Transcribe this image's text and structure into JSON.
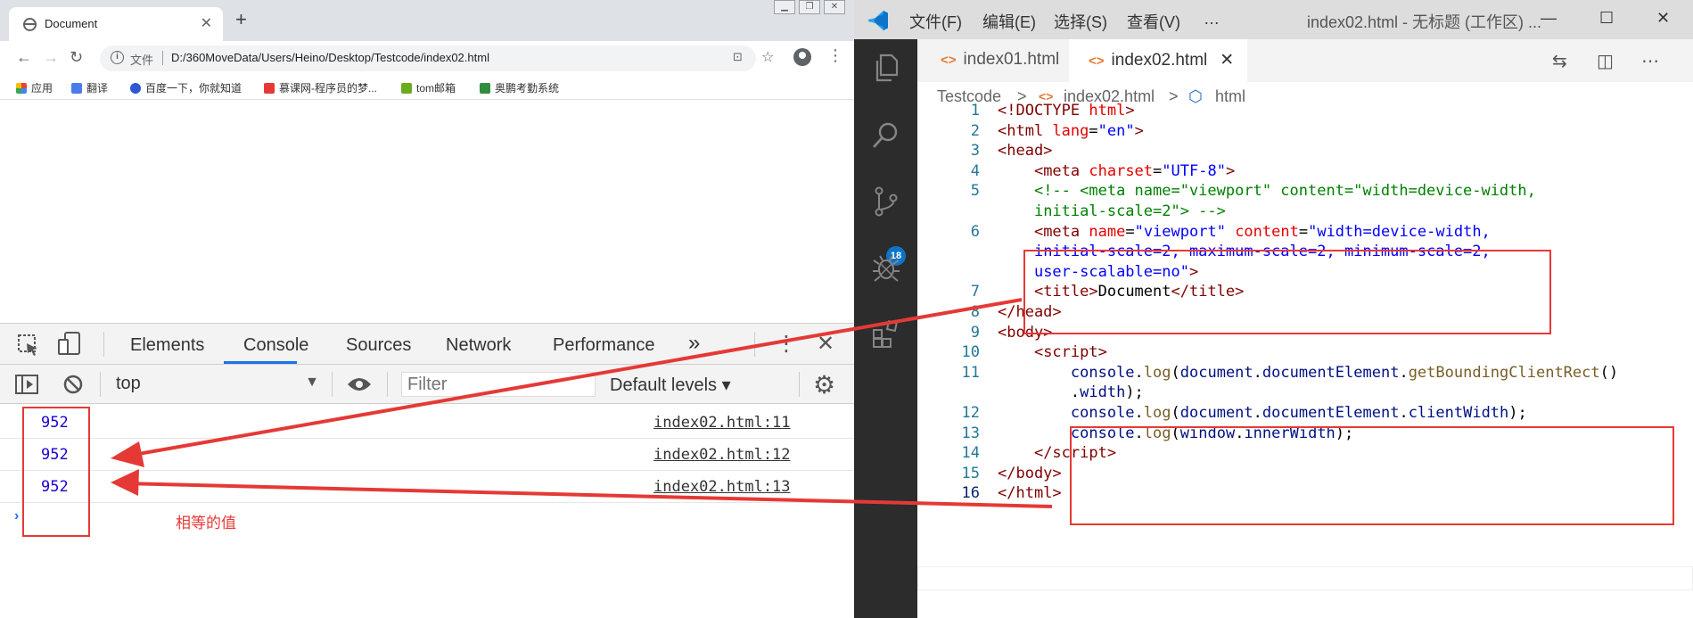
{
  "browser": {
    "tab_title": "Document",
    "tab_close": "✕",
    "new_tab": "+",
    "address_label": "文件",
    "url": "D:/360MoveData/Users/Heino/Desktop/Testcode/index02.html",
    "bookmarks": [
      "应用",
      "翻译",
      "百度一下，你就知道",
      "慕课网-程序员的梦...",
      "tom邮箱",
      "奥鹏考勤系统"
    ]
  },
  "devtools": {
    "tabs": [
      "Elements",
      "Console",
      "Sources",
      "Network",
      "Performance"
    ],
    "active_tab": "Console",
    "more_tabs": "»",
    "context": "top",
    "filter_placeholder": "Filter",
    "levels": "Default levels ▾",
    "messages": [
      {
        "value": "952",
        "source": "index02.html:11"
      },
      {
        "value": "952",
        "source": "index02.html:12"
      },
      {
        "value": "952",
        "source": "index02.html:13"
      }
    ],
    "prompt": "›"
  },
  "annotation": {
    "label": "相等的值",
    "color": "#e53935"
  },
  "vscode": {
    "menu": [
      "文件(F)",
      "编辑(E)",
      "选择(S)",
      "查看(V)",
      "…"
    ],
    "window_title": "index02.html - 无标题 (工作区) ...",
    "window_controls": [
      "—",
      "☐",
      "✕"
    ],
    "tabs": [
      {
        "label": "index01.html",
        "icon": "<>"
      },
      {
        "label": "index02.html",
        "icon": "<>",
        "close": "✕"
      }
    ],
    "breadcrumb": [
      "Testcode",
      "index02.html",
      "html"
    ],
    "breadcrumb_sep": ">",
    "scm_badge": "18",
    "line_numbers": [
      "1",
      "2",
      "3",
      "4",
      "5",
      "6",
      "7",
      "8",
      "9",
      "10",
      "11",
      "12",
      "13",
      "14",
      "15",
      "16"
    ]
  },
  "colors": {
    "accent": "#1a73e8",
    "vscode_activity_bar": "#2c2c2c",
    "vscode_badge": "#0e74c9",
    "annotation_red": "#e53935"
  }
}
